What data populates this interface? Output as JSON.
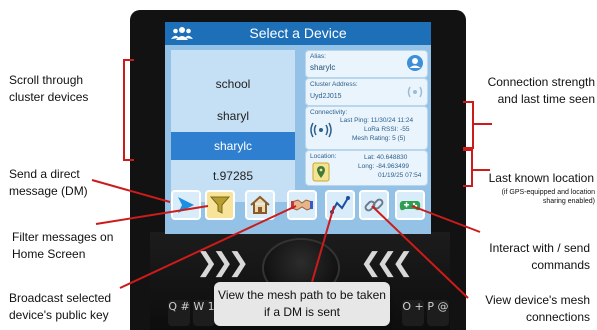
{
  "screen": {
    "title": "Select a Device",
    "devices": [
      "school",
      "sharyl",
      "sharylc",
      "t.97285"
    ],
    "selected_device": "sharylc",
    "alias": {
      "label": "Alias:",
      "value": "sharylc"
    },
    "cluster": {
      "label": "Cluster Address:",
      "value": "Uyd2J015"
    },
    "connectivity": {
      "label": "Connectivity:",
      "last_ping": "Last Ping: 11/30/24 11:24",
      "rssi": "LoRa RSSI: -55",
      "mesh_rating": "Mesh Rating: 5 (5)"
    },
    "location": {
      "label": "Location:",
      "lat": "Lat: 40.648830",
      "long": "Long: -84.963499",
      "time": "01/19/25 07:54"
    }
  },
  "toolbar": [
    {
      "name": "send-dm-button",
      "icon": "arrow-right-icon"
    },
    {
      "name": "filter-button",
      "icon": "filter-icon"
    },
    {
      "name": "home-button",
      "icon": "home-icon"
    },
    {
      "name": "public-key-button",
      "icon": "handshake-icon"
    },
    {
      "name": "mesh-path-button",
      "icon": "path-icon"
    },
    {
      "name": "mesh-connections-button",
      "icon": "link-icon"
    },
    {
      "name": "commands-button",
      "icon": "gamepad-icon"
    }
  ],
  "keyboard": [
    "Q #",
    "W 1",
    "O +",
    "P @"
  ],
  "callouts": {
    "scroll": "Scroll through cluster devices",
    "dm": "Send a direct message (DM)",
    "filter": "Filter messages on Home Screen",
    "broadcast": "Broadcast selected device's public key",
    "connection": "Connection strength and last time seen",
    "location": "Last known location",
    "location_note": "(if GPS-equipped and location sharing enabled)",
    "interact": "Interact with / send commands",
    "mesh": "View device's mesh connections",
    "tooltip": "View the mesh path to be taken if a DM is sent"
  },
  "colors": {
    "accent": "#2f7fd1",
    "arrow": "#cc1b1b",
    "screen_bg": "#93c2e6"
  }
}
